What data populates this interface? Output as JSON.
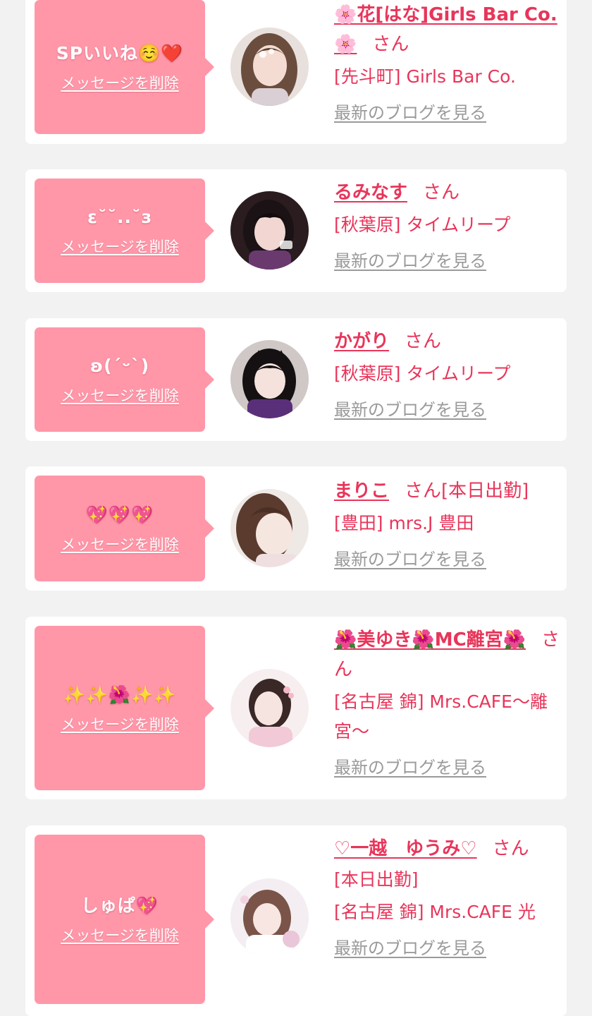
{
  "labels": {
    "delete_message": "メッセージを削除",
    "view_latest_blog": "最新のブログを見る",
    "honorific": "さん"
  },
  "colors": {
    "page_background": "#f2f2f2",
    "card_background": "#ffffff",
    "bubble_background": "#ff97a8",
    "accent_text": "#e8355a",
    "muted_link": "#9a9a9a"
  },
  "cards": [
    {
      "message": "SPいいね☺️❤️",
      "name": "🌸花[はな]Girls Bar Co.🌸",
      "shop": "[先斗町] Girls Bar Co.",
      "status": "",
      "avatar_icon": "cast-photo-avatar"
    },
    {
      "message": "ε˘˘..˘з",
      "name": "るみなす",
      "shop": "[秋葉原] タイムリープ",
      "status": "",
      "avatar_icon": "cast-photo-avatar"
    },
    {
      "message": "ʚ(ˊᵕˋ)",
      "name": "かがり",
      "shop": "[秋葉原] タイムリープ",
      "status": "",
      "avatar_icon": "cast-photo-avatar"
    },
    {
      "message": "💖💖💖",
      "name": "まりこ",
      "status": "[本日出勤]",
      "shop": "[豊田] mrs.J 豊田",
      "avatar_icon": "cast-photo-avatar"
    },
    {
      "message": "✨✨🌺✨✨",
      "name": "🌺美ゆき🌺MC離宮🌺",
      "shop": "[名古屋 錦] Mrs.CAFE〜離宮〜",
      "status": "",
      "avatar_icon": "cast-photo-avatar"
    },
    {
      "message": "しゅぱ💖",
      "name": "♡一越　ゆうみ♡",
      "status": "[本日出勤]",
      "shop": "[名古屋 錦] Mrs.CAFE 光",
      "avatar_icon": "cast-photo-avatar"
    }
  ]
}
